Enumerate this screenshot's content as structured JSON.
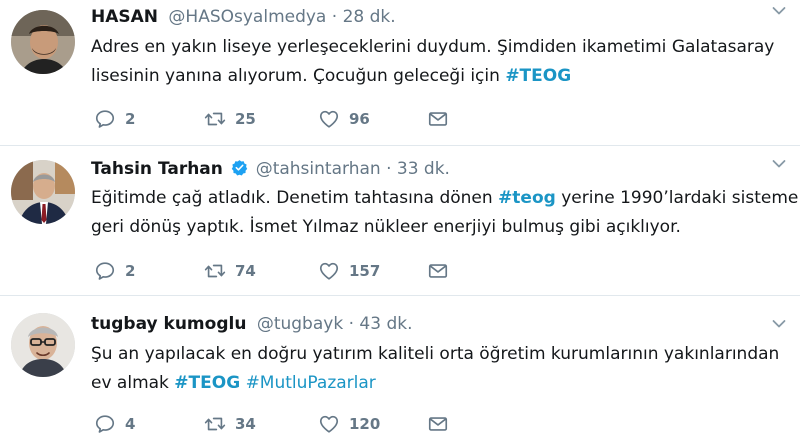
{
  "tweets": [
    {
      "name": "HASAN",
      "verified": false,
      "handle": "@HASOsyalmedya",
      "dot": "·",
      "time": "28 dk.",
      "line1": "Adres en yakın liseye yerleşeceklerini duydum. Şimdiden ikametimi Galatasaray",
      "line2_text": "lisesinin yanına alıyorum. Çocuğun geleceği için ",
      "line2_tag": "#TEOG",
      "replies": "2",
      "retweets": "25",
      "likes": "96"
    },
    {
      "name": "Tahsin Tarhan",
      "verified": true,
      "handle": "@tahsintarhan",
      "dot": "·",
      "time": "33 dk.",
      "line1_a": "Eğitimde çağ atladık. Denetim tahtasına dönen ",
      "line1_tag": "#teog",
      "line1_b": " yerine 1990’lardaki sisteme",
      "line2": "geri dönüş yaptık. İsmet Yılmaz nükleer enerjiyi bulmuş gibi açıklıyor.",
      "replies": "2",
      "retweets": "74",
      "likes": "157"
    },
    {
      "name": "tugbay kumoglu",
      "verified": false,
      "handle": "@tugbayk",
      "dot": "·",
      "time": "43 dk.",
      "line1": "Şu an yapılacak en doğru yatırım kaliteli orta öğretim kurumlarının yakınlarından",
      "line2_text": "ev almak ",
      "line2_tag1": "#TEOG",
      "line2_tag2": "#MutluPazarlar",
      "replies": "4",
      "retweets": "34",
      "likes": "120"
    }
  ],
  "icons": {
    "reply": "reply-icon",
    "retweet": "retweet-icon",
    "like": "heart-icon",
    "dm": "envelope-icon",
    "more": "chevron-down-icon",
    "verified": "verified-badge-icon"
  },
  "colors": {
    "text": "#14171a",
    "muted": "#657786",
    "hashtag": "#1b95c5",
    "verified": "#1da1f2",
    "divider": "#e1e8ed"
  }
}
